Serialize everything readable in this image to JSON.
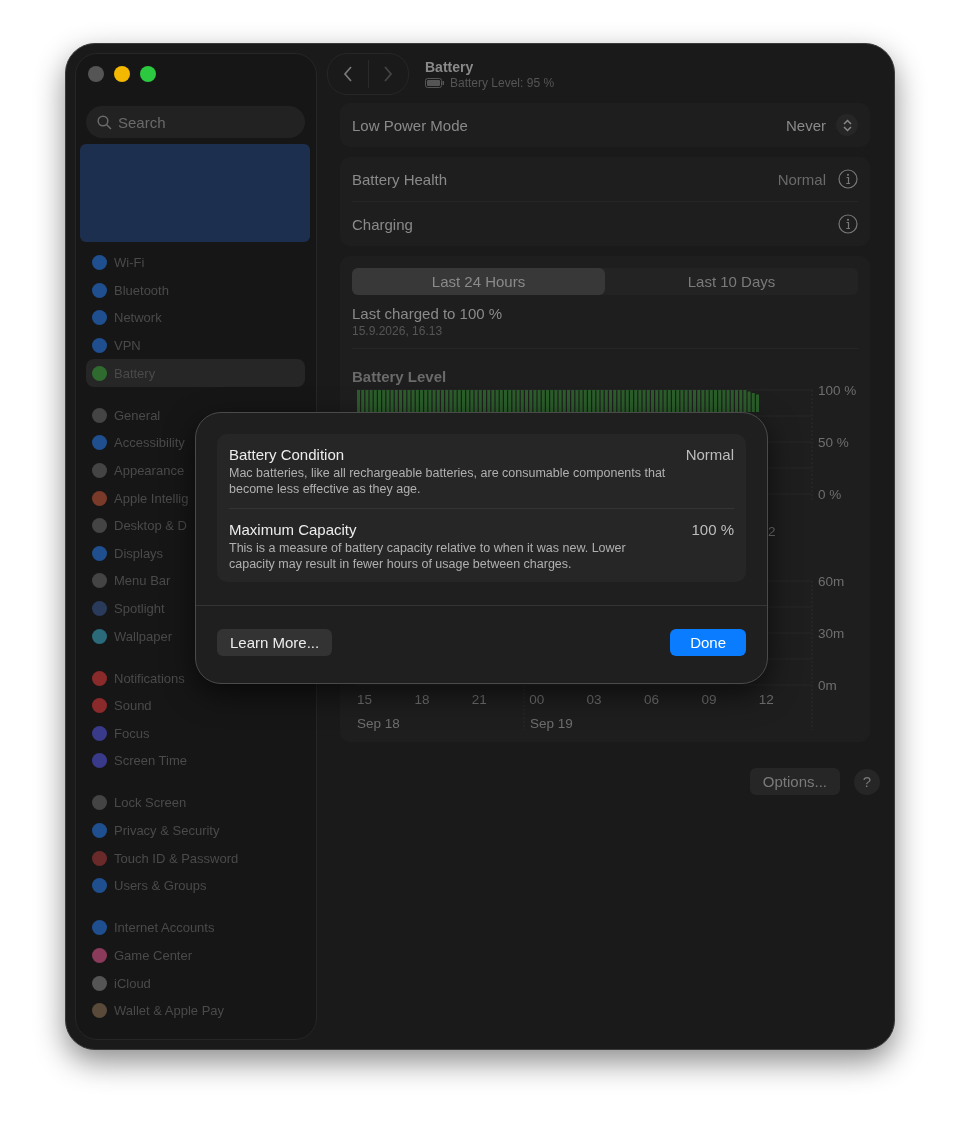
{
  "window": {
    "title": "Battery",
    "subtitle": "Battery Level: 95 %"
  },
  "sidebar": {
    "search": {
      "placeholder": "Search"
    },
    "groups": [
      [
        {
          "label": "Wi-Fi",
          "color": "#1f4f8f",
          "selected": false
        },
        {
          "label": "Bluetooth",
          "color": "#1f4f8f",
          "selected": false
        },
        {
          "label": "Network",
          "color": "#1f4f8f",
          "selected": false
        },
        {
          "label": "VPN",
          "color": "#1f4f8f",
          "selected": false
        },
        {
          "label": "Battery",
          "color": "#2f6b2f",
          "selected": true
        }
      ],
      [
        {
          "label": "General",
          "color": "#444444",
          "selected": false
        },
        {
          "label": "Accessibility",
          "color": "#1f4f8f",
          "selected": false
        },
        {
          "label": "Appearance",
          "color": "#444444",
          "selected": false
        },
        {
          "label": "Apple Intellig",
          "color": "#7a3a2a",
          "selected": false
        },
        {
          "label": "Desktop & D",
          "color": "#444444",
          "selected": false
        },
        {
          "label": "Displays",
          "color": "#1f4f8f",
          "selected": false
        },
        {
          "label": "Menu Bar",
          "color": "#444444",
          "selected": false
        },
        {
          "label": "Spotlight",
          "color": "#2a3a5a",
          "selected": false
        },
        {
          "label": "Wallpaper",
          "color": "#2a6a7a",
          "selected": false
        }
      ],
      [
        {
          "label": "Notifications",
          "color": "#8a2a2a",
          "selected": false
        },
        {
          "label": "Sound",
          "color": "#8a2a2a",
          "selected": false
        },
        {
          "label": "Focus",
          "color": "#3a3a8a",
          "selected": false
        },
        {
          "label": "Screen Time",
          "color": "#3a3a8a",
          "selected": false
        }
      ],
      [
        {
          "label": "Lock Screen",
          "color": "#444444",
          "selected": false
        },
        {
          "label": "Privacy & Security",
          "color": "#1f4f8f",
          "selected": false
        },
        {
          "label": "Touch ID & Password",
          "color": "#6a2a2a",
          "selected": false
        },
        {
          "label": "Users & Groups",
          "color": "#1f4f8f",
          "selected": false
        }
      ],
      [
        {
          "label": "Internet Accounts",
          "color": "#1f4f8f",
          "selected": false
        },
        {
          "label": "Game Center",
          "color": "#8a3a5a",
          "selected": false
        },
        {
          "label": "iCloud",
          "color": "#555555",
          "selected": false
        },
        {
          "label": "Wallet & Apple Pay",
          "color": "#5a4a3a",
          "selected": false
        }
      ]
    ]
  },
  "low_power": {
    "label": "Low Power Mode",
    "value": "Never"
  },
  "health_card": [
    {
      "label": "Battery Health",
      "value": "Normal"
    },
    {
      "label": "Charging"
    }
  ],
  "tabs": [
    {
      "label": "Last 24 Hours",
      "selected": true
    },
    {
      "label": "Last 10 Days",
      "selected": false
    }
  ],
  "last_charged": {
    "title": "Last charged to 100 %",
    "date": "15.9.2026, 16.13"
  },
  "battery_chart": {
    "title": "Battery Level",
    "y_labels": [
      "100 %",
      "50 %",
      "0 %"
    ],
    "x_labels": [
      "2"
    ]
  },
  "usage_chart": {
    "y_labels": [
      "60m",
      "30m",
      "0m"
    ],
    "x_labels": [
      "15",
      "18",
      "21",
      "00",
      "03",
      "06",
      "09",
      "12"
    ],
    "dates": [
      "Sep 18",
      "Sep 19"
    ]
  },
  "buttons": {
    "options": "Options...",
    "help": "?"
  },
  "dialog": {
    "rows": [
      {
        "title": "Battery Condition",
        "value": "Normal",
        "text": "Mac batteries, like all rechargeable batteries, are consumable components that become less effective as they age."
      },
      {
        "title": "Maximum Capacity",
        "value": "100 %",
        "text": "This is a measure of battery capacity relative to when it was new. Lower capacity may result in fewer hours of usage between charges."
      }
    ],
    "buttons": [
      {
        "label": "Learn More...",
        "kind": "secondary"
      },
      {
        "label": "Done",
        "kind": "primary"
      }
    ]
  }
}
